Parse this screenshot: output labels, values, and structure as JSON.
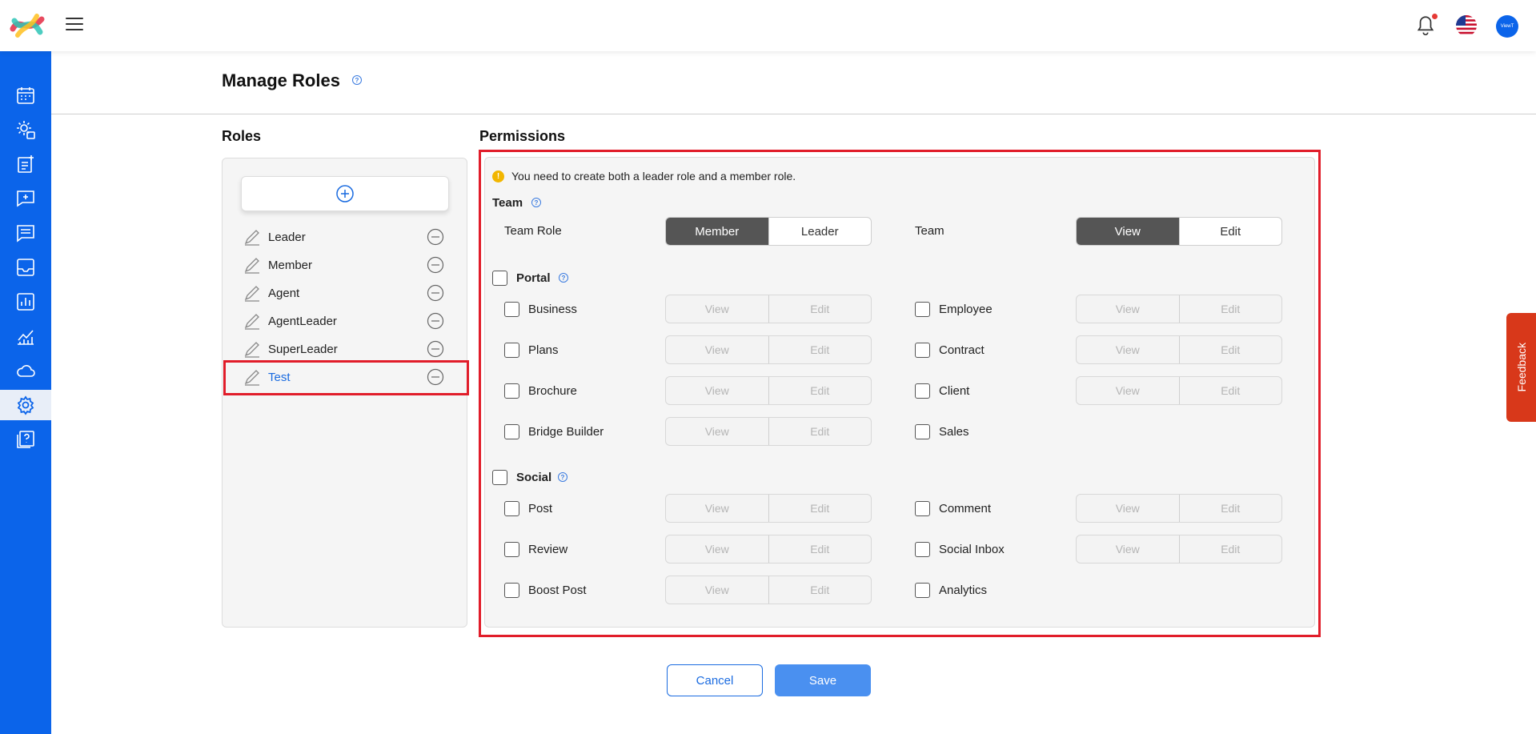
{
  "header": {
    "avatar_text": "ViewT"
  },
  "page": {
    "title": "Manage Roles"
  },
  "roles": {
    "heading": "Roles",
    "items": [
      {
        "label": "Leader"
      },
      {
        "label": "Member"
      },
      {
        "label": "Agent"
      },
      {
        "label": "AgentLeader"
      },
      {
        "label": "SuperLeader"
      },
      {
        "label": "Test",
        "selected": true
      }
    ]
  },
  "permissions": {
    "heading": "Permissions",
    "info": "You need to create both a leader role and a member role.",
    "team": {
      "label": "Team",
      "role_label": "Team Role",
      "role_options": [
        "Member",
        "Leader"
      ],
      "role_selected": "Member",
      "access_label": "Team",
      "access_options": [
        "View",
        "Edit"
      ],
      "access_selected": "View"
    },
    "portal": {
      "label": "Portal",
      "left": [
        {
          "label": "Business",
          "view": "View",
          "edit": "Edit"
        },
        {
          "label": "Plans",
          "view": "View",
          "edit": "Edit"
        },
        {
          "label": "Brochure",
          "view": "View",
          "edit": "Edit"
        },
        {
          "label": "Bridge Builder",
          "view": "View",
          "edit": "Edit"
        }
      ],
      "right": [
        {
          "label": "Employee",
          "view": "View",
          "edit": "Edit"
        },
        {
          "label": "Contract",
          "view": "View",
          "edit": "Edit"
        },
        {
          "label": "Client",
          "view": "View",
          "edit": "Edit"
        },
        {
          "label": "Sales"
        }
      ]
    },
    "social": {
      "label": "Social",
      "left": [
        {
          "label": "Post",
          "view": "View",
          "edit": "Edit"
        },
        {
          "label": "Review",
          "view": "View",
          "edit": "Edit"
        },
        {
          "label": "Boost Post",
          "view": "View",
          "edit": "Edit"
        }
      ],
      "right": [
        {
          "label": "Comment",
          "view": "View",
          "edit": "Edit"
        },
        {
          "label": "Social Inbox",
          "view": "View",
          "edit": "Edit"
        },
        {
          "label": "Analytics"
        }
      ]
    }
  },
  "actions": {
    "cancel": "Cancel",
    "save": "Save"
  },
  "feedback": {
    "label": "Feedback"
  },
  "colors": {
    "brand": "#0b64ea",
    "highlight": "#e11d2a",
    "save": "#4a90f0",
    "feedback": "#d8381a"
  }
}
